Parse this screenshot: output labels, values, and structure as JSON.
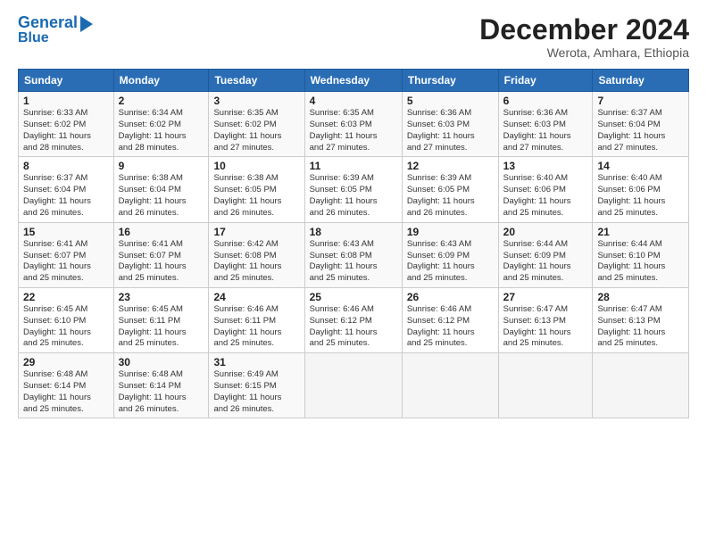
{
  "header": {
    "logo_line1": "General",
    "logo_line2": "Blue",
    "title": "December 2024",
    "subtitle": "Werota, Amhara, Ethiopia"
  },
  "calendar": {
    "days_of_week": [
      "Sunday",
      "Monday",
      "Tuesday",
      "Wednesday",
      "Thursday",
      "Friday",
      "Saturday"
    ],
    "weeks": [
      [
        {
          "day": "1",
          "info": "Sunrise: 6:33 AM\nSunset: 6:02 PM\nDaylight: 11 hours\nand 28 minutes."
        },
        {
          "day": "2",
          "info": "Sunrise: 6:34 AM\nSunset: 6:02 PM\nDaylight: 11 hours\nand 28 minutes."
        },
        {
          "day": "3",
          "info": "Sunrise: 6:35 AM\nSunset: 6:02 PM\nDaylight: 11 hours\nand 27 minutes."
        },
        {
          "day": "4",
          "info": "Sunrise: 6:35 AM\nSunset: 6:03 PM\nDaylight: 11 hours\nand 27 minutes."
        },
        {
          "day": "5",
          "info": "Sunrise: 6:36 AM\nSunset: 6:03 PM\nDaylight: 11 hours\nand 27 minutes."
        },
        {
          "day": "6",
          "info": "Sunrise: 6:36 AM\nSunset: 6:03 PM\nDaylight: 11 hours\nand 27 minutes."
        },
        {
          "day": "7",
          "info": "Sunrise: 6:37 AM\nSunset: 6:04 PM\nDaylight: 11 hours\nand 27 minutes."
        }
      ],
      [
        {
          "day": "8",
          "info": "Sunrise: 6:37 AM\nSunset: 6:04 PM\nDaylight: 11 hours\nand 26 minutes."
        },
        {
          "day": "9",
          "info": "Sunrise: 6:38 AM\nSunset: 6:04 PM\nDaylight: 11 hours\nand 26 minutes."
        },
        {
          "day": "10",
          "info": "Sunrise: 6:38 AM\nSunset: 6:05 PM\nDaylight: 11 hours\nand 26 minutes."
        },
        {
          "day": "11",
          "info": "Sunrise: 6:39 AM\nSunset: 6:05 PM\nDaylight: 11 hours\nand 26 minutes."
        },
        {
          "day": "12",
          "info": "Sunrise: 6:39 AM\nSunset: 6:05 PM\nDaylight: 11 hours\nand 26 minutes."
        },
        {
          "day": "13",
          "info": "Sunrise: 6:40 AM\nSunset: 6:06 PM\nDaylight: 11 hours\nand 25 minutes."
        },
        {
          "day": "14",
          "info": "Sunrise: 6:40 AM\nSunset: 6:06 PM\nDaylight: 11 hours\nand 25 minutes."
        }
      ],
      [
        {
          "day": "15",
          "info": "Sunrise: 6:41 AM\nSunset: 6:07 PM\nDaylight: 11 hours\nand 25 minutes."
        },
        {
          "day": "16",
          "info": "Sunrise: 6:41 AM\nSunset: 6:07 PM\nDaylight: 11 hours\nand 25 minutes."
        },
        {
          "day": "17",
          "info": "Sunrise: 6:42 AM\nSunset: 6:08 PM\nDaylight: 11 hours\nand 25 minutes."
        },
        {
          "day": "18",
          "info": "Sunrise: 6:43 AM\nSunset: 6:08 PM\nDaylight: 11 hours\nand 25 minutes."
        },
        {
          "day": "19",
          "info": "Sunrise: 6:43 AM\nSunset: 6:09 PM\nDaylight: 11 hours\nand 25 minutes."
        },
        {
          "day": "20",
          "info": "Sunrise: 6:44 AM\nSunset: 6:09 PM\nDaylight: 11 hours\nand 25 minutes."
        },
        {
          "day": "21",
          "info": "Sunrise: 6:44 AM\nSunset: 6:10 PM\nDaylight: 11 hours\nand 25 minutes."
        }
      ],
      [
        {
          "day": "22",
          "info": "Sunrise: 6:45 AM\nSunset: 6:10 PM\nDaylight: 11 hours\nand 25 minutes."
        },
        {
          "day": "23",
          "info": "Sunrise: 6:45 AM\nSunset: 6:11 PM\nDaylight: 11 hours\nand 25 minutes."
        },
        {
          "day": "24",
          "info": "Sunrise: 6:46 AM\nSunset: 6:11 PM\nDaylight: 11 hours\nand 25 minutes."
        },
        {
          "day": "25",
          "info": "Sunrise: 6:46 AM\nSunset: 6:12 PM\nDaylight: 11 hours\nand 25 minutes."
        },
        {
          "day": "26",
          "info": "Sunrise: 6:46 AM\nSunset: 6:12 PM\nDaylight: 11 hours\nand 25 minutes."
        },
        {
          "day": "27",
          "info": "Sunrise: 6:47 AM\nSunset: 6:13 PM\nDaylight: 11 hours\nand 25 minutes."
        },
        {
          "day": "28",
          "info": "Sunrise: 6:47 AM\nSunset: 6:13 PM\nDaylight: 11 hours\nand 25 minutes."
        }
      ],
      [
        {
          "day": "29",
          "info": "Sunrise: 6:48 AM\nSunset: 6:14 PM\nDaylight: 11 hours\nand 25 minutes."
        },
        {
          "day": "30",
          "info": "Sunrise: 6:48 AM\nSunset: 6:14 PM\nDaylight: 11 hours\nand 26 minutes."
        },
        {
          "day": "31",
          "info": "Sunrise: 6:49 AM\nSunset: 6:15 PM\nDaylight: 11 hours\nand 26 minutes."
        },
        {
          "day": "",
          "info": ""
        },
        {
          "day": "",
          "info": ""
        },
        {
          "day": "",
          "info": ""
        },
        {
          "day": "",
          "info": ""
        }
      ]
    ]
  }
}
